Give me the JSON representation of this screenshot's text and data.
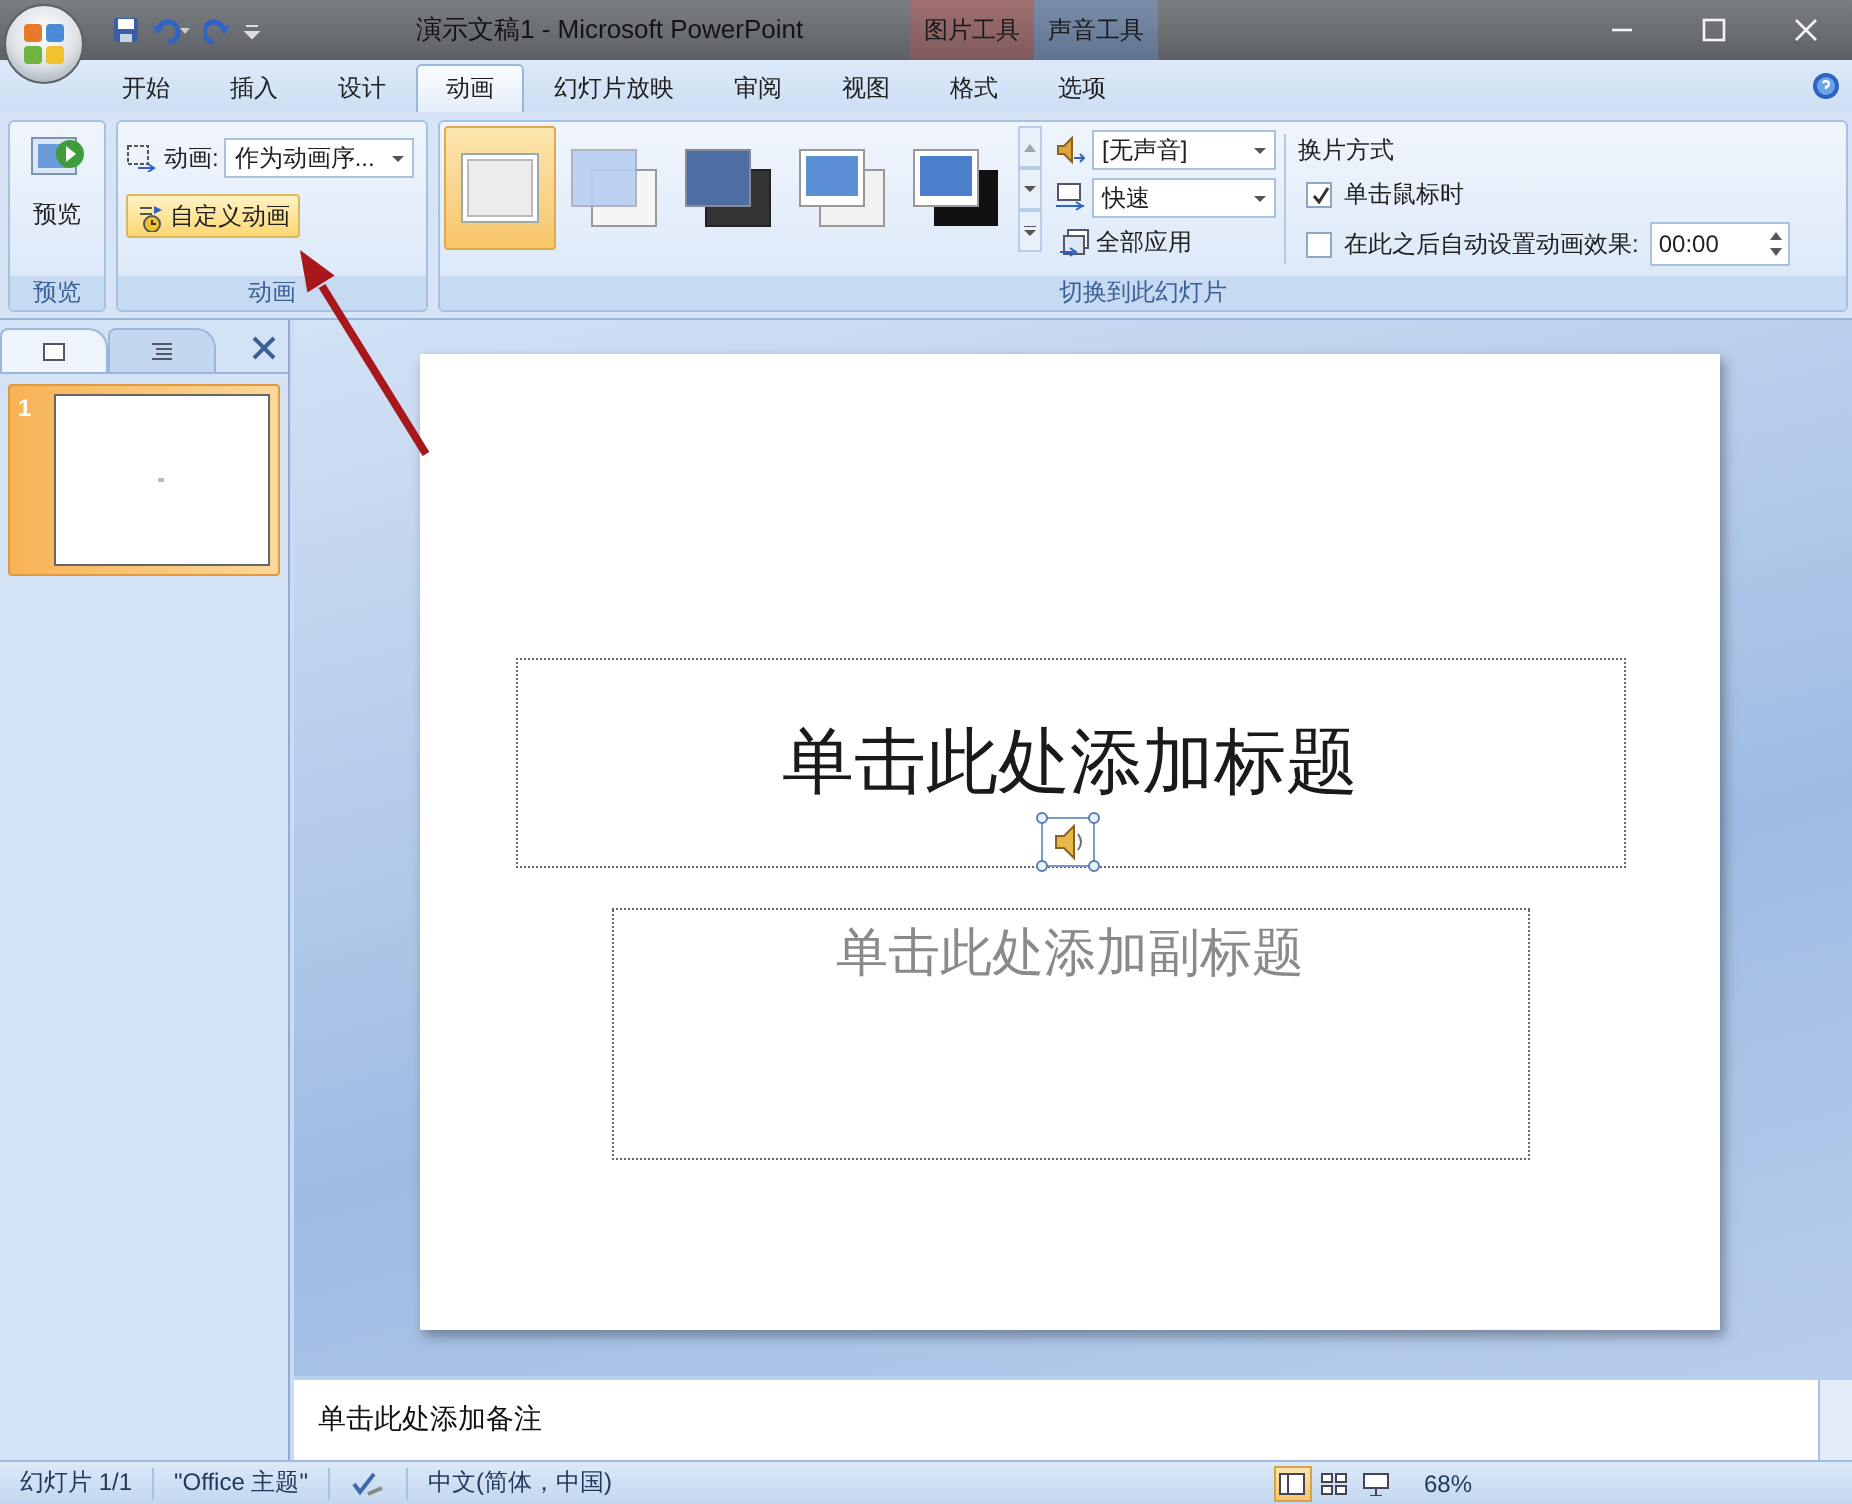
{
  "title_bar": {
    "title": "演示文稿1 - Microsoft PowerPoint",
    "contextual_tabs": [
      {
        "label": "图片工具",
        "kind": "picture"
      },
      {
        "label": "声音工具",
        "kind": "sound"
      }
    ]
  },
  "tabs": [
    {
      "label": "开始",
      "selected": false
    },
    {
      "label": "插入",
      "selected": false
    },
    {
      "label": "设计",
      "selected": false
    },
    {
      "label": "动画",
      "selected": true
    },
    {
      "label": "幻灯片放映",
      "selected": false
    },
    {
      "label": "审阅",
      "selected": false
    },
    {
      "label": "视图",
      "selected": false
    },
    {
      "label": "格式",
      "selected": false
    },
    {
      "label": "选项",
      "selected": false
    }
  ],
  "ribbon": {
    "preview": {
      "button": "预览",
      "group_label": "预览"
    },
    "animation": {
      "label": "动画:",
      "dropdown": "作为动画序...",
      "custom_button": "自定义动画",
      "group_label": "动画"
    },
    "transition": {
      "gallery": [
        {
          "kind": "plain",
          "selected": true
        },
        {
          "kind": "fade",
          "selected": false
        },
        {
          "kind": "dark",
          "selected": false
        },
        {
          "kind": "blue",
          "selected": false
        },
        {
          "kind": "black",
          "selected": false
        }
      ],
      "sound": "[无声音]",
      "speed": "快速",
      "apply_all": "全部应用",
      "group_label": "切换到此幻灯片",
      "advance": {
        "title": "换片方式",
        "on_click": {
          "label": "单击鼠标时",
          "checked": true
        },
        "after": {
          "label": "在此之后自动设置动画效果:",
          "checked": false,
          "time": "00:00"
        }
      }
    }
  },
  "slides_pane": {
    "tabs": [
      {
        "kind": "slides",
        "selected": true
      },
      {
        "kind": "outline",
        "selected": false
      }
    ],
    "slides": [
      {
        "number": "1",
        "selected": true
      }
    ]
  },
  "slide": {
    "title_placeholder": "单击此处添加标题",
    "subtitle_placeholder": "单击此处添加副标题"
  },
  "notes": {
    "prompt": "单击此处添加备注"
  },
  "status_bar": {
    "slide": "幻灯片 1/1",
    "theme": "\"Office 主题\"",
    "language": "中文(简体，中国)",
    "views": [
      {
        "kind": "normal",
        "selected": true
      },
      {
        "kind": "sorter",
        "selected": false
      },
      {
        "kind": "slideshow",
        "selected": false
      }
    ],
    "zoom": "68%"
  }
}
